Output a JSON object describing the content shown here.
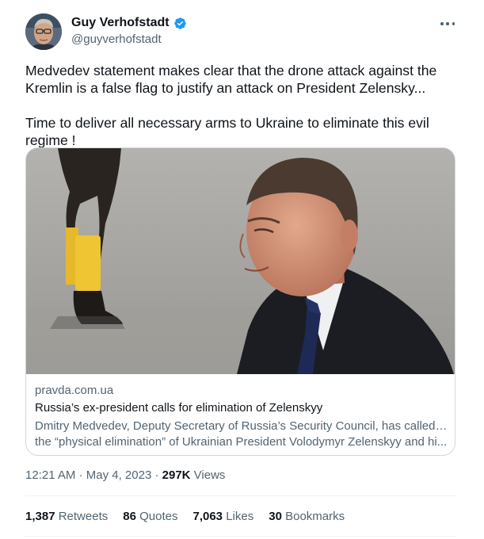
{
  "author": {
    "display_name": "Guy Verhofstadt",
    "handle": "@guyverhofstadt",
    "verified": true,
    "avatar_icon": "profile-photo"
  },
  "tweet": {
    "text": "Medvedev statement makes clear that the drone attack against the Kremlin is a false flag to justify an attack on President Zelensky...\n\nTime to deliver all necessary arms to Ukraine to eliminate this evil regime !"
  },
  "link_card": {
    "domain": "pravda.com.ua",
    "title": "Russia’s ex-president calls for elimination of Zelenskyy",
    "description_line1": "Dmitry Medvedev, Deputy Secretary of Russia’s Security Council, has called for",
    "description_line2": "the “physical elimination” of Ukrainian President Volodymyr Zelenskyy and hi..."
  },
  "meta": {
    "time": "12:21 AM",
    "separator": "·",
    "date": "May 4, 2023",
    "views_count": "297K",
    "views_label": "Views"
  },
  "stats": {
    "retweets_count": "1,387",
    "retweets_label": "Retweets",
    "quotes_count": "86",
    "quotes_label": "Quotes",
    "likes_count": "7,063",
    "likes_label": "Likes",
    "bookmarks_count": "30",
    "bookmarks_label": "Bookmarks"
  },
  "colors": {
    "text_primary": "#0f1419",
    "text_secondary": "#536471",
    "verified_blue": "#1d9bf0",
    "border": "#cfd9de"
  }
}
